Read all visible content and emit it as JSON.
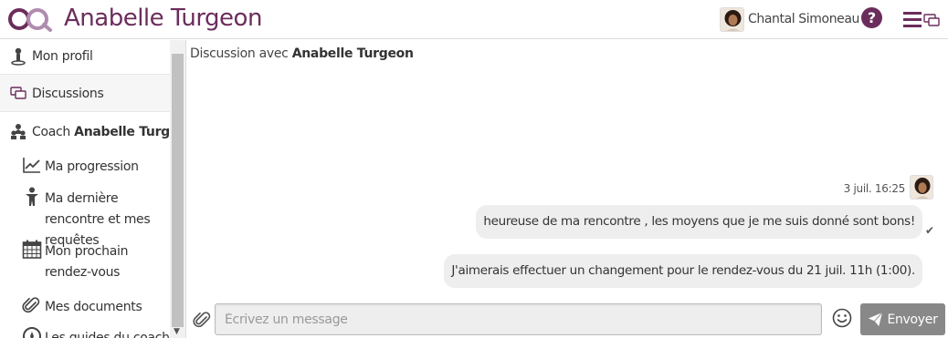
{
  "header": {
    "app_title": "Anabelle Turgeon",
    "user_name": "Chantal Simoneau",
    "help_label": "?",
    "brand_color": "#6b2d5c"
  },
  "sidebar": {
    "items": [
      {
        "label": "Mon profil",
        "icon": "person-pin-icon"
      },
      {
        "label": "Discussions",
        "icon": "chat-bubbles-icon"
      },
      {
        "label_prefix": "Coach",
        "label_strong": "Anabelle Turgeon",
        "icon": "people-icon"
      }
    ],
    "subitems": [
      {
        "label": "Ma progression",
        "icon": "chart-line-icon"
      },
      {
        "label": "Ma dernière rencontre et mes requêtes",
        "icon": "person-icon"
      },
      {
        "label": "Mon prochain rendez-vous",
        "icon": "calendar-icon"
      },
      {
        "label": "Mes documents",
        "icon": "paperclip-icon"
      },
      {
        "label": "Les guides du coach",
        "icon": "compass-icon"
      }
    ]
  },
  "chat": {
    "title_prefix": "Discussion avec",
    "title_name": "Anabelle Turgeon",
    "messages_meta": "3 juil. 16:25",
    "messages": [
      {
        "text": "heureuse de ma rencontre , les moyens que je me suis donné sont bons!",
        "status": "✔"
      },
      {
        "text": "J'aimerais effectuer un changement pour le rendez-vous du 21 juil. 11h (1:00)."
      }
    ],
    "input_placeholder": "Écrivez un message",
    "send_label": "Envoyer"
  }
}
